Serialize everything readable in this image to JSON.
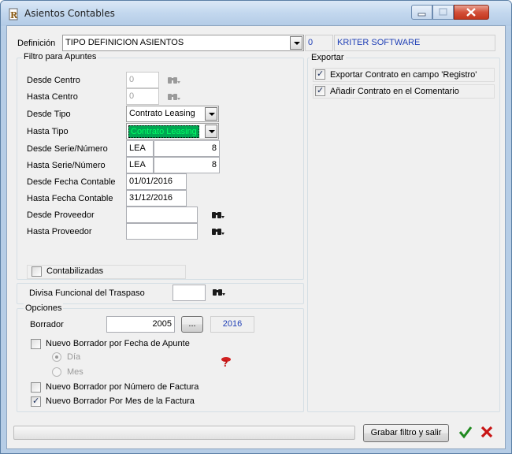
{
  "window": {
    "title": "Asientos Contables"
  },
  "definicion": {
    "label": "Definición",
    "value": "TIPO DEFINICION ASIENTOS",
    "code": "0",
    "company": "KRITER SOFTWARE"
  },
  "filtro": {
    "title": "Filtro para Apuntes",
    "desde_centro": {
      "label": "Desde Centro",
      "value": "0"
    },
    "hasta_centro": {
      "label": "Hasta Centro",
      "value": "0"
    },
    "desde_tipo": {
      "label": "Desde Tipo",
      "value": "Contrato Leasing"
    },
    "hasta_tipo": {
      "label": "Hasta Tipo",
      "value": "Contrato Leasing"
    },
    "desde_serie": {
      "label": "Desde Serie/Número",
      "serie": "LEA",
      "numero": "8"
    },
    "hasta_serie": {
      "label": "Hasta Serie/Número",
      "serie": "LEA",
      "numero": "8"
    },
    "desde_fecha": {
      "label": "Desde Fecha Contable",
      "value": "01/01/2016"
    },
    "hasta_fecha": {
      "label": "Hasta Fecha Contable",
      "value": "31/12/2016"
    },
    "desde_proveedor": {
      "label": "Desde Proveedor",
      "value": ""
    },
    "hasta_proveedor": {
      "label": "Hasta Proveedor",
      "value": ""
    },
    "contabilizadas": {
      "label": "Contabilizadas",
      "checked": false
    }
  },
  "divisa": {
    "label": "Divisa Funcional del Traspaso",
    "value": ""
  },
  "opciones": {
    "title": "Opciones",
    "borrador": {
      "label": "Borrador",
      "value": "2005",
      "browse_label": "...",
      "year": "2016"
    },
    "nuevo_fecha": {
      "label": "Nuevo Borrador por Fecha de Apunte",
      "checked": false
    },
    "dia": {
      "label": "Día",
      "selected": true
    },
    "mes": {
      "label": "Mes",
      "selected": false
    },
    "nuevo_factura": {
      "label": "Nuevo Borrador por Número de Factura",
      "checked": false
    },
    "nuevo_mes": {
      "label": "Nuevo Borrador Por Mes de la Factura",
      "checked": true
    }
  },
  "exportar": {
    "title": "Exportar",
    "contrato_registro": {
      "label": "Exportar Contrato en campo 'Registro'",
      "checked": true
    },
    "contrato_comentario": {
      "label": "Añadir Contrato en el Comentario",
      "checked": true
    }
  },
  "footer": {
    "grabar_label": "Grabar filtro y salir"
  },
  "colors": {
    "accent_blue": "#1f3fb6",
    "highlight_green": "#00a651",
    "highlight_fg": "#00ff66"
  }
}
